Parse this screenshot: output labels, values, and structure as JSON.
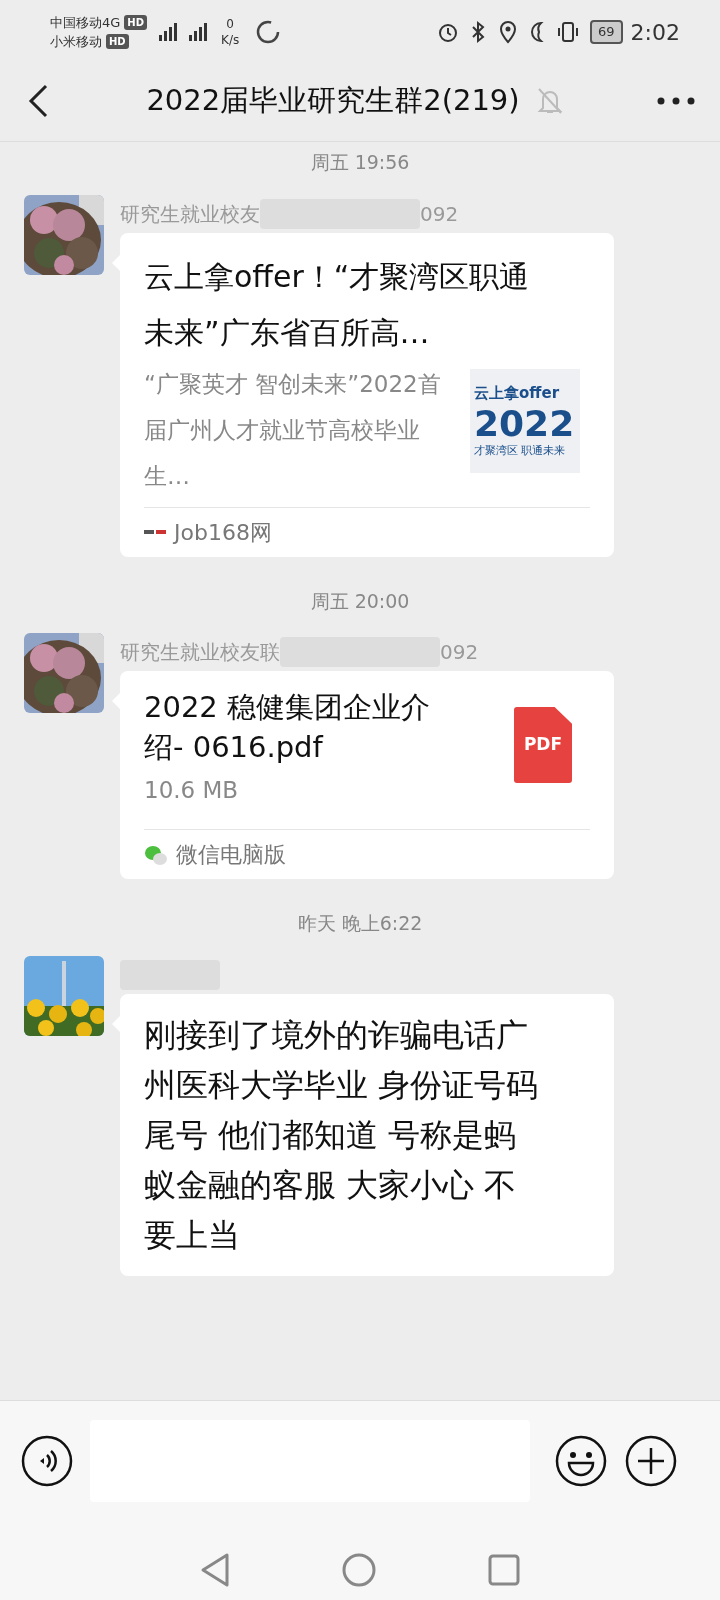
{
  "status_bar": {
    "carrier_1": "中国移动4G",
    "carrier_1_badge": "HD",
    "carrier_2": "小米移动",
    "carrier_2_badge": "HD",
    "net_speed": "0",
    "net_unit": "K/s",
    "battery": "69",
    "time": "2:02"
  },
  "header": {
    "title": "2022届毕业研究生群2(219)",
    "muted": true
  },
  "messages": [
    {
      "kind": "time",
      "text": "周五 19:56"
    },
    {
      "kind": "link",
      "sender_prefix": "研究生就业校友",
      "sender_suffix": "092",
      "sender_redacted": true,
      "title": "云上拿offer！“才聚湾区职通未来”广东省百所高…",
      "summary": "“广聚英才 智创未来”2022首届广州人才就业节高校毕业生…",
      "thumb_line_1": "云上拿offer",
      "thumb_line_2": "2022",
      "thumb_line_3": "才聚湾区 职通未来",
      "source": "Job168网"
    },
    {
      "kind": "time",
      "text": "周五 20:00"
    },
    {
      "kind": "file",
      "sender_prefix": "研究生就业校友联",
      "sender_suffix": "092",
      "sender_redacted": true,
      "file_name": "2022 稳健集团企业介绍- 0616.pdf",
      "size": "10.6 MB",
      "file_type": "PDF",
      "source": "微信电脑版"
    },
    {
      "kind": "time",
      "text": "昨天 晚上6:22"
    },
    {
      "kind": "text",
      "sender_redacted": true,
      "text": "刚接到了境外的诈骗电话广州医科大学毕业 身份证号码尾号 他们都知道 号称是蚂蚁金融的客服 大家小心 不要上当"
    }
  ]
}
